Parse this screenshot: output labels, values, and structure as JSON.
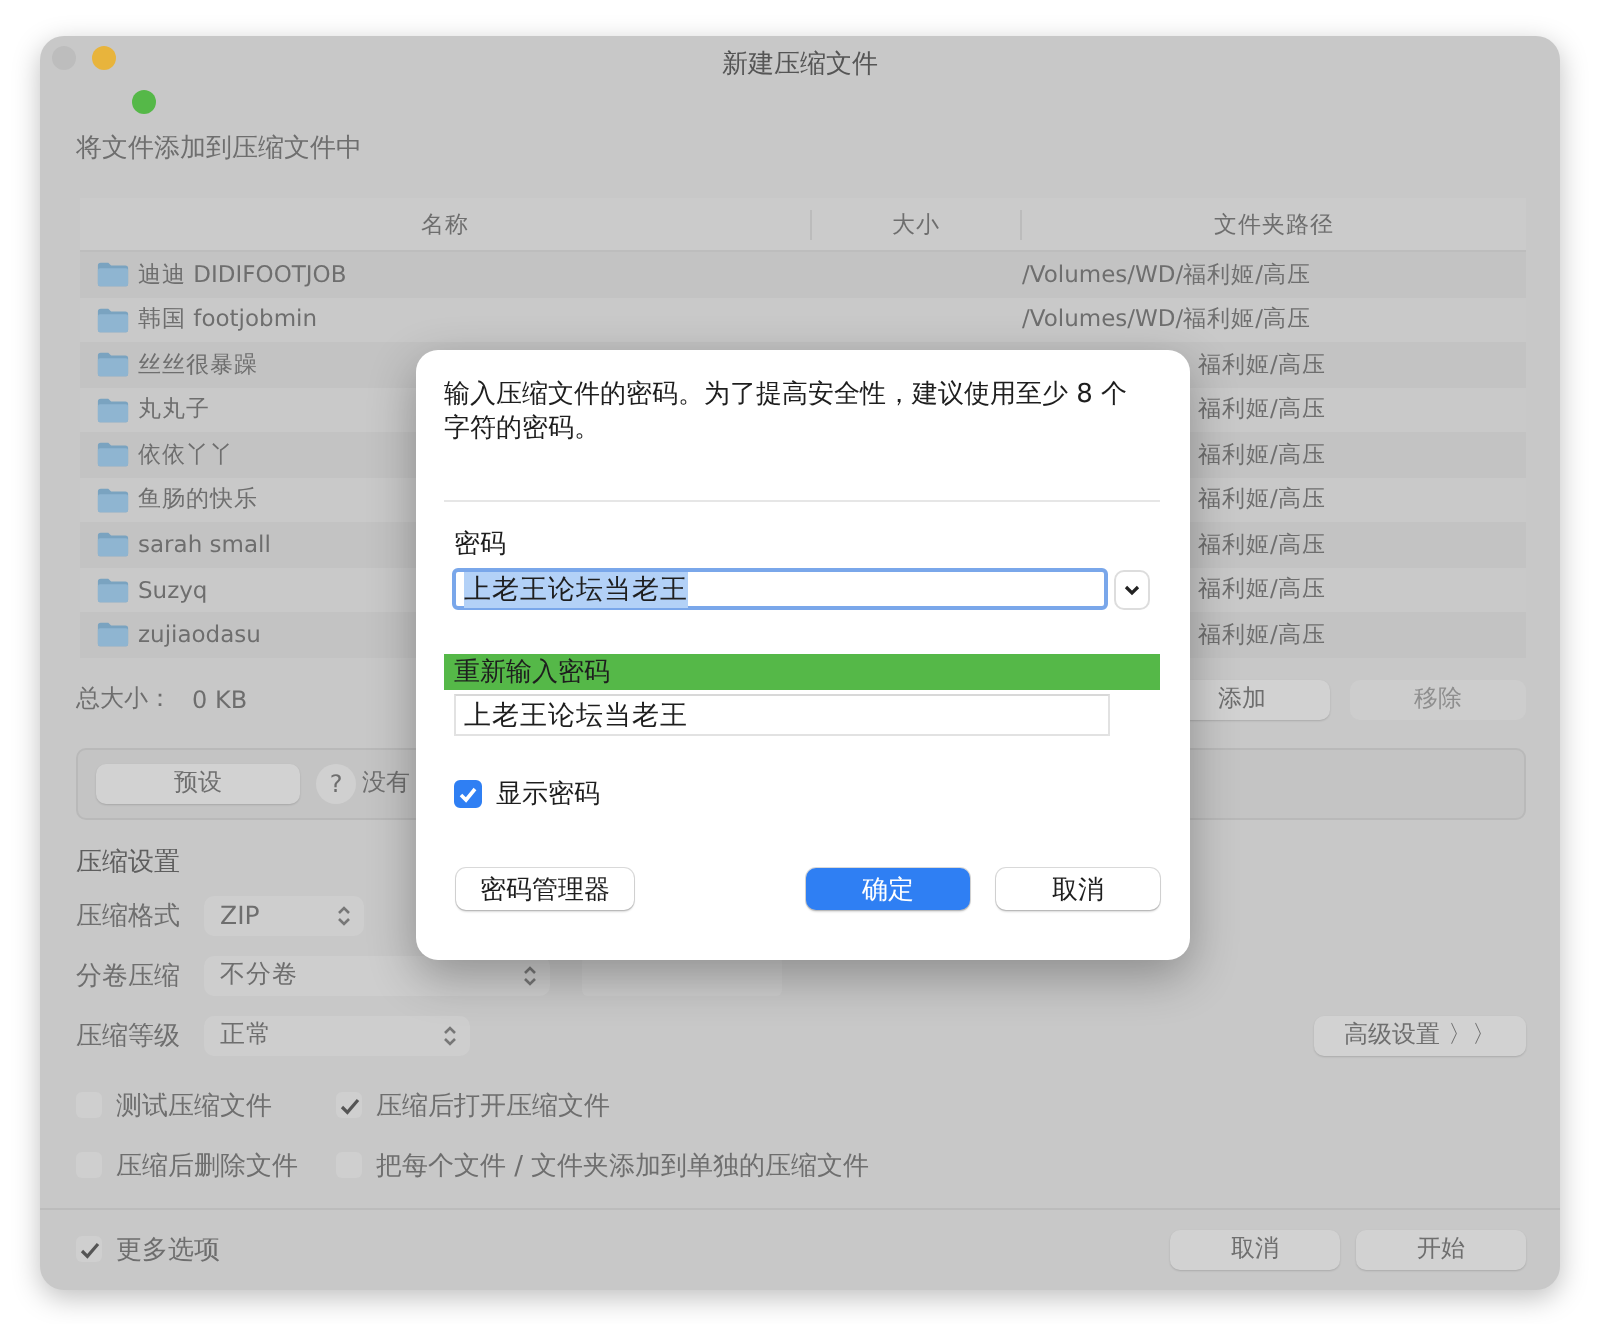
{
  "window": {
    "title": "新建压缩文件"
  },
  "heading": "将文件添加到压缩文件中",
  "table": {
    "columns": [
      "名称",
      "大小",
      "文件夹路径"
    ],
    "rows": [
      {
        "name": "迪迪 DIDIFOOTJOB",
        "path": "/Volumes/WD/福利姬/高压",
        "kind": "full"
      },
      {
        "name": "韩国 footjobmin",
        "path": "/Volumes/WD/福利姬/高压",
        "kind": "full"
      },
      {
        "name": "丝丝很暴躁",
        "path": "福利姬/高压",
        "kind": "partial"
      },
      {
        "name": "丸丸子",
        "path": "福利姬/高压",
        "kind": "partial"
      },
      {
        "name": "依依丫丫",
        "path": "福利姬/高压",
        "kind": "partial"
      },
      {
        "name": "鱼肠的快乐",
        "path": "福利姬/高压",
        "kind": "partial"
      },
      {
        "name": "sarah small",
        "path": "福利姬/高压",
        "kind": "partial"
      },
      {
        "name": "Suzyq",
        "path": "福利姬/高压",
        "kind": "partial"
      },
      {
        "name": "zujiaodasu",
        "path": "福利姬/高压",
        "kind": "partial"
      }
    ]
  },
  "total_size": {
    "label": "总大小：",
    "value": "0 KB"
  },
  "list_buttons": [
    {
      "label": "添加",
      "disabled": false
    },
    {
      "label": "移除",
      "disabled": true
    }
  ],
  "preset": {
    "button": "预设",
    "help": "?",
    "text": "没有"
  },
  "settings": {
    "title": "压缩设置",
    "rows": [
      {
        "label": "压缩格式",
        "value": "ZIP"
      },
      {
        "label": "分卷压缩",
        "value": "不分卷"
      },
      {
        "label": "压缩等级",
        "value": "正常"
      }
    ],
    "advanced_button": "高级设置 〉〉",
    "options": [
      {
        "label": "测试压缩文件",
        "checked": false
      },
      {
        "label": "压缩后打开压缩文件",
        "checked": true
      },
      {
        "label": "压缩后删除文件",
        "checked": false
      },
      {
        "label": "把每个文件 / 文件夹添加到单独的压缩文件",
        "checked": false
      }
    ]
  },
  "more_options": {
    "label": "更多选项",
    "checked": true
  },
  "footer_buttons": [
    "取消",
    "开始"
  ],
  "dialog": {
    "message": "输入压缩文件的密码。为了提高安全性，建议使用至少 8 个字符的密码。",
    "password_label": "密码",
    "password": "上老王论坛当老王",
    "confirm_label": "重新输入密码",
    "confirm": "上老王论坛当老王",
    "show_password": {
      "label": "显示密码",
      "checked": true
    },
    "manager_button": "密码管理器",
    "ok_button": "确定",
    "cancel_button": "取消"
  }
}
